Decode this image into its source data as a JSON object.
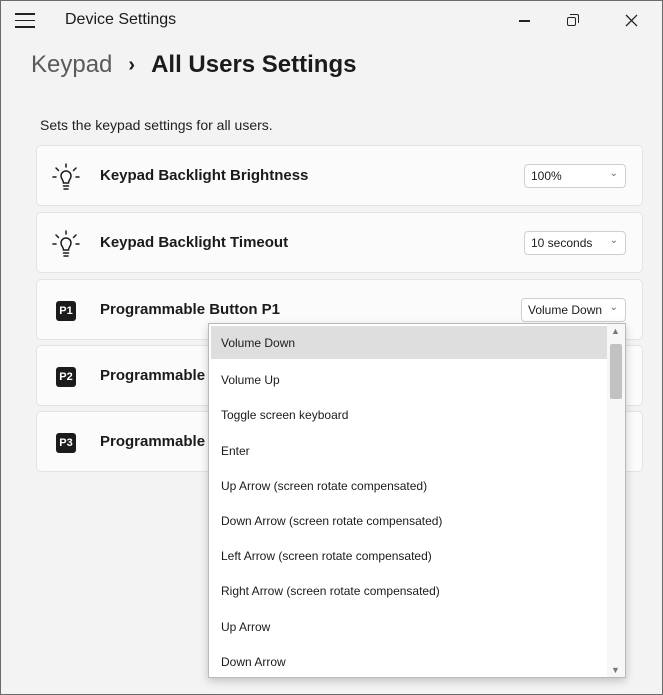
{
  "window": {
    "title": "Device Settings"
  },
  "breadcrumb": {
    "parent": "Keypad",
    "separator": "›",
    "current": "All Users Settings"
  },
  "description": "Sets the keypad settings for all users.",
  "settings": [
    {
      "label": "Keypad Backlight Brightness",
      "icon": "lightbulb-icon",
      "value": "100%"
    },
    {
      "label": "Keypad Backlight Timeout",
      "icon": "lightbulb-icon",
      "value": "10 seconds"
    },
    {
      "label": "Programmable Button P1",
      "icon": "p1-badge-icon",
      "badge": "P1",
      "value": "Volume Down"
    },
    {
      "label": "Programmable",
      "icon": "p2-badge-icon",
      "badge": "P2"
    },
    {
      "label": "Programmable",
      "icon": "p3-badge-icon",
      "badge": "P3"
    }
  ],
  "dropdown": {
    "selected": "Volume Down",
    "options": [
      "Volume Down",
      "Volume Up",
      "Toggle screen keyboard",
      "Enter",
      "Up Arrow (screen rotate compensated)",
      "Down Arrow (screen rotate compensated)",
      "Left Arrow (screen rotate compensated)",
      "Right Arrow (screen rotate compensated)",
      "Up Arrow",
      "Down Arrow"
    ]
  }
}
